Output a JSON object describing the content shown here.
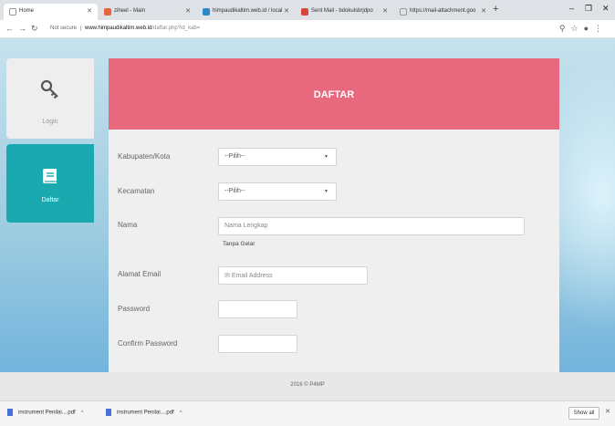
{
  "browser": {
    "tabs": [
      {
        "label": "Home",
        "color": "#ffffff"
      },
      {
        "label": "ziheel - Main",
        "color": "#e8643c"
      },
      {
        "label": "himpaudikaltim.web.id / local",
        "color": "#2a8ac7"
      },
      {
        "label": "Sent Mail - bdokulsbrjdpo",
        "color": "#d44638"
      },
      {
        "label": "https://mail-attachment.goo",
        "color": "#ffffff"
      }
    ],
    "url_secure": "Not secure",
    "url_host": "www.himpaudikaltim.web.id",
    "url_path": "/daftar.php?id_kab="
  },
  "sidebar": {
    "login_label": "Login",
    "daftar_label": "Daftar"
  },
  "form": {
    "title": "DAFTAR",
    "kabupaten_label": "Kabupaten/Kota",
    "kabupaten_value": "--Pilih--",
    "kecamatan_label": "Kecamatan",
    "kecamatan_value": "--Pilih--",
    "nama_label": "Nama",
    "nama_placeholder": "Nama Lengkap",
    "nama_hint": "Tanpa Gelar",
    "email_label": "Alamat Email",
    "email_placeholder": "Email Address",
    "password_label": "Password",
    "confirm_label": "Confirm Password"
  },
  "footer": {
    "text": "2016 © P4MP"
  },
  "downloads": {
    "items": [
      "instrument Penilai....pdf",
      "instrument Penilai....pdf"
    ],
    "show_all": "Show all"
  },
  "colors": {
    "header_pink": "#e8697d",
    "daftar_teal": "#1aa9ae"
  }
}
